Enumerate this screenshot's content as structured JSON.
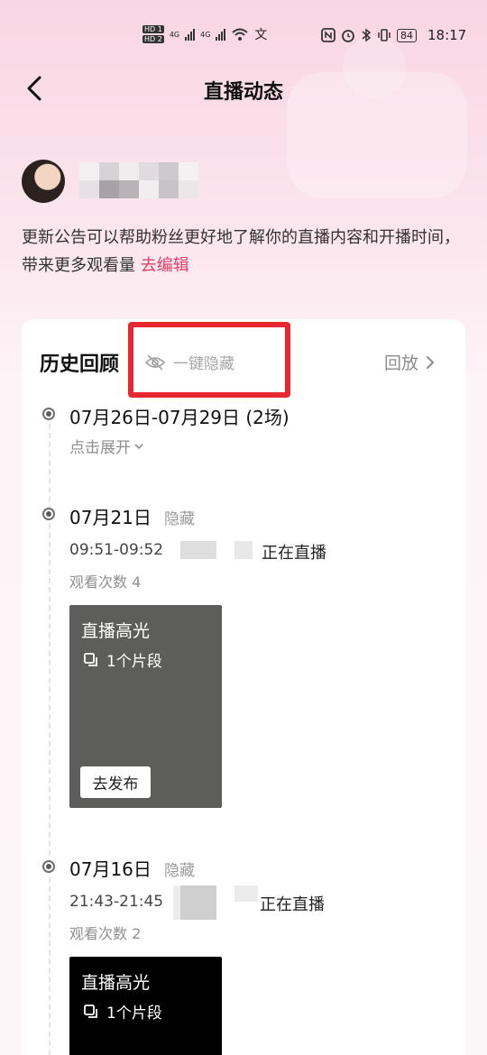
{
  "status_bar": {
    "hd1": "HD 1",
    "hd2": "HD 2",
    "net1": "4G",
    "net2": "4G",
    "battery": "84",
    "time": "18:17"
  },
  "header": {
    "title": "直播动态",
    "back_icon": "chevron-left-icon"
  },
  "notice": {
    "text": "更新公告可以帮助粉丝更好地了解你的直播内容和开播时间，带来更多观看量",
    "edit_link": "去编辑"
  },
  "history": {
    "title": "历史回顾",
    "hide_all": "一键隐藏",
    "replay": "回放",
    "groups": [
      {
        "date": "07月26日-07月29日 (2场)",
        "expand": "点击展开"
      }
    ],
    "sessions": [
      {
        "date": "07月21日",
        "hidden_label": "隐藏",
        "time_range": "09:51-09:52",
        "status": "正在直播",
        "views": "观看次数 4",
        "highlight_title": "直播高光",
        "clips": "1个片段",
        "publish": "去发布"
      },
      {
        "date": "07月16日",
        "hidden_label": "隐藏",
        "time_range": "21:43-21:45",
        "status": "正在直播",
        "views": "观看次数 2",
        "highlight_title": "直播高光",
        "clips": "1个片段"
      }
    ]
  },
  "colors": {
    "accent_link": "#e33e65",
    "highlight_box": "#e8282e",
    "thumb1_bg": "#5d5d5b",
    "thumb2_bg": "#000000"
  }
}
